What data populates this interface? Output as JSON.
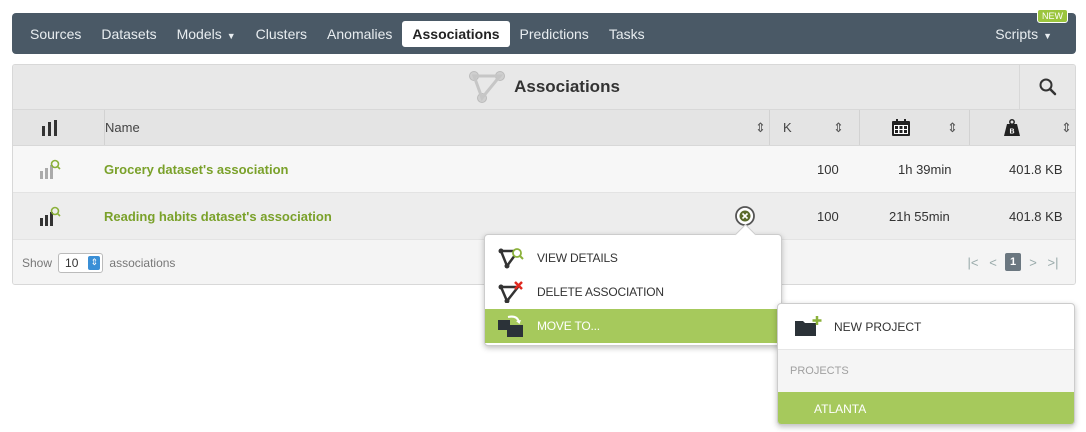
{
  "nav": {
    "items": [
      {
        "label": "Sources"
      },
      {
        "label": "Datasets"
      },
      {
        "label": "Models"
      },
      {
        "label": "Clusters"
      },
      {
        "label": "Anomalies"
      },
      {
        "label": "Associations"
      },
      {
        "label": "Predictions"
      },
      {
        "label": "Tasks"
      }
    ],
    "scripts_label": "Scripts",
    "new_badge": "NEW"
  },
  "panel": {
    "title": "Associations",
    "columns": {
      "name": "Name",
      "k": "K"
    }
  },
  "rows": [
    {
      "name": "Grocery dataset's association",
      "k": "100",
      "age": "1h 39min",
      "size": "401.8 KB"
    },
    {
      "name": "Reading habits dataset's association",
      "k": "100",
      "age": "21h 55min",
      "size": "401.8 KB"
    }
  ],
  "footer": {
    "show_label": "Show",
    "show_value": "10",
    "suffix": "associations",
    "current_page": "1"
  },
  "context_menu": {
    "items": [
      {
        "label": "VIEW DETAILS"
      },
      {
        "label": "DELETE ASSOCIATION"
      },
      {
        "label": "MOVE TO..."
      }
    ]
  },
  "submenu": {
    "new_project": "NEW PROJECT",
    "section": "PROJECTS",
    "projects": [
      {
        "label": "ATLANTA"
      }
    ]
  },
  "colors": {
    "accent": "#a6c95c",
    "link_green": "#7aa12a",
    "nav_bg": "#4a5966"
  }
}
